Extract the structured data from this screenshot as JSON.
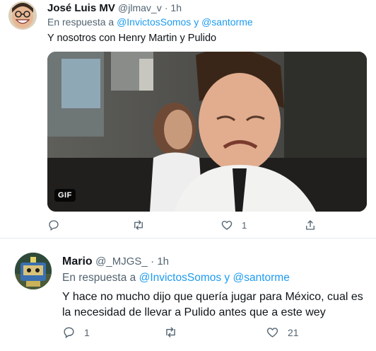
{
  "tweets": [
    {
      "name": "José Luis MV",
      "handle": "@jlmav_v",
      "time": "· 1h",
      "reply_prefix": "En respuesta a",
      "mention1": "@InvictosSomos",
      "reply_join": "y",
      "mention2": "@santorme",
      "text": "Y nosotros con Henry Martin y Pulido",
      "media_badge": "GIF",
      "avatar_icon": "smiling-face-avatar",
      "actions": {
        "reply_count": "",
        "retweet_count": "",
        "like_count": "1",
        "share_icon": "share-icon"
      }
    },
    {
      "name": "Mario",
      "handle": "@_MJGS_",
      "time": "· 1h",
      "reply_prefix": "En respuesta a",
      "mention1": "@InvictosSomos",
      "reply_join": "y",
      "mention2": "@santorme",
      "text": "Y hace no mucho dijo que quería jugar para México, cual es la necesidad de llevar a Pulido antes que a este wey",
      "avatar_icon": "robot-avatar",
      "actions": {
        "reply_count": "1",
        "retweet_count": "",
        "like_count": "21"
      }
    }
  ],
  "colors": {
    "accent": "#1d9bf0",
    "secondary_text": "#536471",
    "primary_text": "#0f1419",
    "divider": "#e6ecf0"
  }
}
